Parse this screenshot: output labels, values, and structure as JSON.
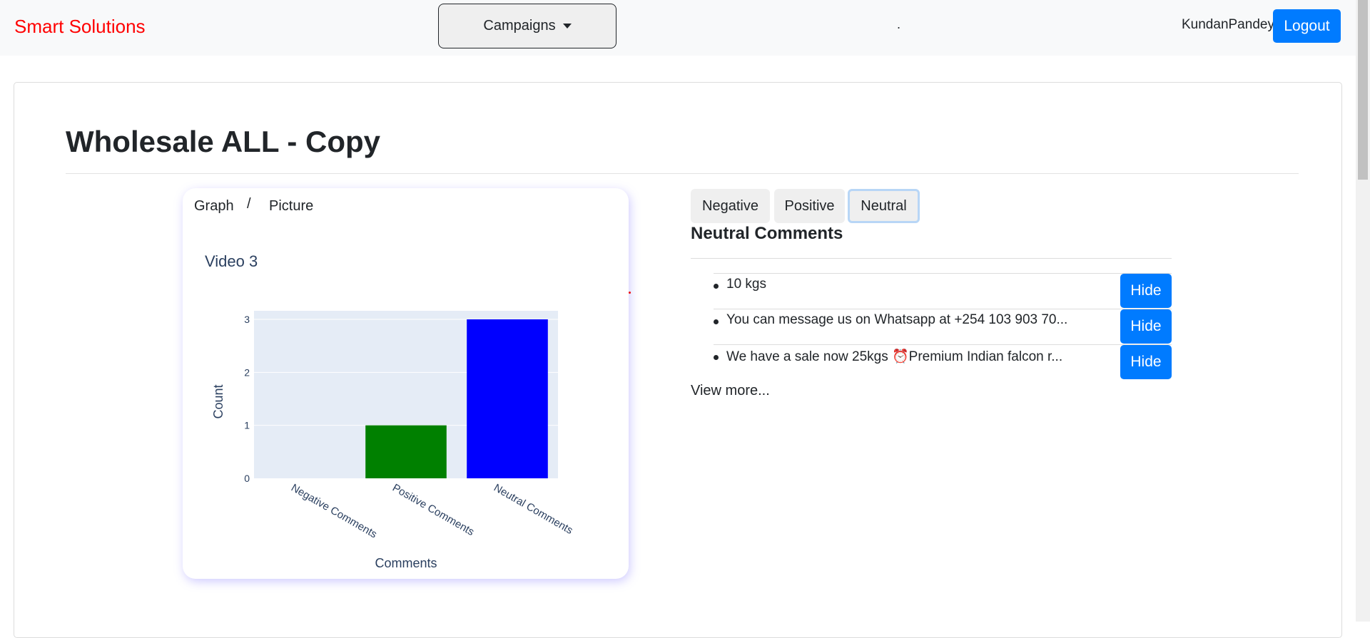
{
  "navbar": {
    "brand": "Smart Solutions",
    "campaigns_label": "Campaigns",
    "dot": ".",
    "username": "KundanPandey",
    "logout_label": "Logout"
  },
  "page": {
    "title": "Wholesale ALL - Copy"
  },
  "graph_panel": {
    "tab_graph": "Graph",
    "separator": "/",
    "tab_picture": "Picture"
  },
  "chart_data": {
    "type": "bar",
    "title": "Video 3",
    "categories": [
      "Negative Comments",
      "Positive Comments",
      "Neutral Comments"
    ],
    "values": [
      0,
      1,
      3
    ],
    "colors": [
      "#ff0000",
      "#008000",
      "#0000ff"
    ],
    "xlabel": "Comments",
    "ylabel": "Count",
    "ylim": [
      0,
      3
    ],
    "yticks": [
      "0",
      "1",
      "2",
      "3"
    ],
    "plot_bgcolor": "#e5ecf6",
    "grid": true
  },
  "filters": [
    {
      "label": "Negative",
      "active": false
    },
    {
      "label": "Positive",
      "active": false
    },
    {
      "label": "Neutral",
      "active": true
    }
  ],
  "comments": {
    "heading": "Neutral Comments",
    "items": [
      {
        "text": "10 kgs",
        "action": "Hide"
      },
      {
        "text": "You can message us on Whatsapp at +254 103 903 70...",
        "action": "Hide"
      },
      {
        "text": "We have a sale now 25kgs ⏰Premium Indian falcon r...",
        "action": "Hide"
      }
    ],
    "view_more": "View more..."
  }
}
